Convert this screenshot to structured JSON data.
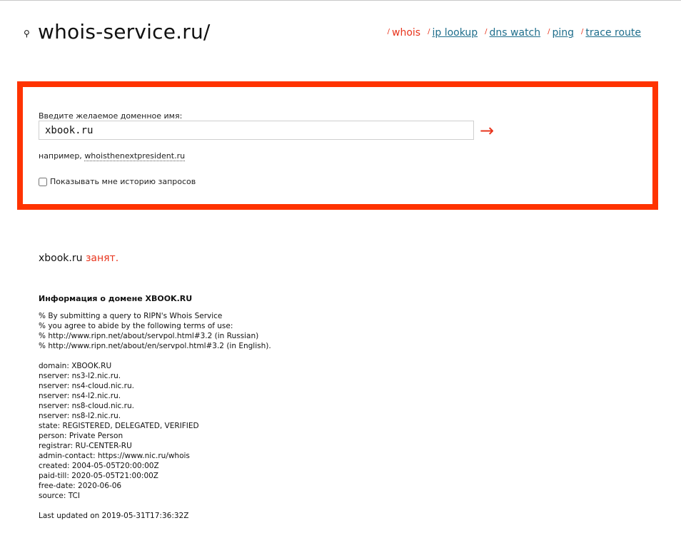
{
  "header": {
    "logo_icon": "⚲",
    "logo_text": "whois-service.ru/",
    "nav": [
      {
        "slash": "/",
        "label": "whois",
        "active": true
      },
      {
        "slash": "/",
        "label": "ip lookup",
        "active": false
      },
      {
        "slash": "/",
        "label": "dns watch",
        "active": false
      },
      {
        "slash": "/",
        "label": "ping",
        "active": false
      },
      {
        "slash": "/",
        "label": "trace route",
        "active": false
      }
    ]
  },
  "search": {
    "label": "Введите желаемое доменное имя:",
    "value": "xbook.ru",
    "submit_icon": "→",
    "example_prefix": "например, ",
    "example_link": "whoisthenextpresident.ru",
    "history_label": "Показывать мне историю запросов",
    "history_checked": false
  },
  "result": {
    "domain": "xbook.ru",
    "status": "занят."
  },
  "info": {
    "title": "Информация о домене XBOOK.RU",
    "lines": [
      "% By submitting a query to RIPN's Whois Service",
      "% you agree to abide by the following terms of use:",
      "% http://www.ripn.net/about/servpol.html#3.2 (in Russian)",
      "% http://www.ripn.net/about/en/servpol.html#3.2 (in English).",
      "",
      "domain: XBOOK.RU",
      "nserver: ns3-l2.nic.ru.",
      "nserver: ns4-cloud.nic.ru.",
      "nserver: ns4-l2.nic.ru.",
      "nserver: ns8-cloud.nic.ru.",
      "nserver: ns8-l2.nic.ru.",
      "state: REGISTERED, DELEGATED, VERIFIED",
      "person: Private Person",
      "registrar: RU-CENTER-RU",
      "admin-contact: https://www.nic.ru/whois",
      "created: 2004-05-05T20:00:00Z",
      "paid-till: 2020-05-05T21:00:00Z",
      "free-date: 2020-06-06",
      "source: TCI",
      "",
      "Last updated on 2019-05-31T17:36:32Z"
    ]
  }
}
